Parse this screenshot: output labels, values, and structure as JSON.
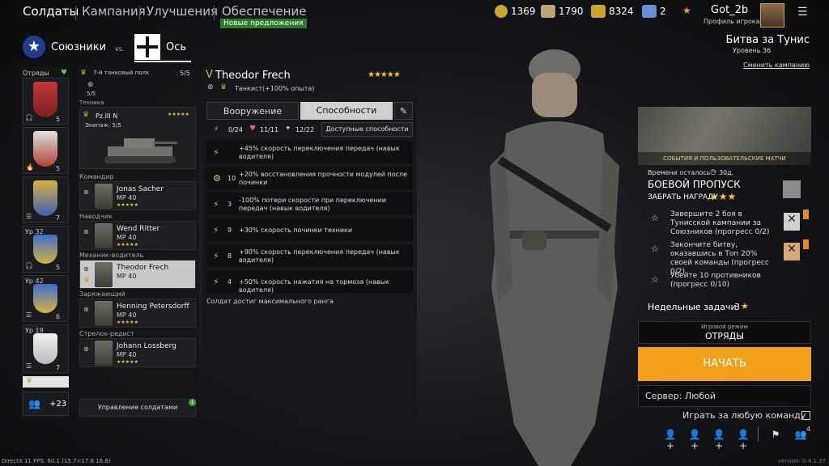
{
  "nav": {
    "tabs": [
      "Солдаты",
      "Кампания",
      "Улучшения",
      "Обеспечение"
    ],
    "new_offers": "Новые предложения"
  },
  "currency": [
    {
      "name": "gold",
      "value": "1369",
      "color": "#c9a534"
    },
    {
      "name": "silver-cards",
      "value": "1790",
      "color": "#b9a57a"
    },
    {
      "name": "gold-cards",
      "value": "8324",
      "color": "#c9a534"
    },
    {
      "name": "blue-cards",
      "value": "2",
      "color": "#6b8fd6"
    }
  ],
  "player": {
    "name": "Got_2b",
    "profile_label": "Профиль игрока"
  },
  "factions": {
    "allies": "Союзники",
    "vs": "vs.",
    "axis": "Ось"
  },
  "campaign": {
    "title": "Битва за Тунис",
    "level": "Уровень 36",
    "change": "Сменить кампанию"
  },
  "squads": {
    "header": "Отряды",
    "cards": [
      {
        "count": "5"
      },
      {
        "count": "5"
      },
      {
        "count": "7"
      },
      {
        "level": "Ур 32",
        "count": "5"
      },
      {
        "level": "Ур 42",
        "count": "6"
      },
      {
        "level": "Ур 19",
        "count": "7"
      }
    ],
    "extra": "+23"
  },
  "squad_detail": {
    "name": "7-й танковый полк",
    "capacity": "5/5",
    "sub_capacity": "5/5",
    "vehicle_label": "Техника",
    "vehicle_name": "Pz.III N",
    "crew": "Экипаж: 5/5",
    "manage": "Управление солдатами",
    "manage_badge": "1",
    "soldiers": [
      {
        "role": "Командир",
        "name": "Jonas Sacher",
        "weapon": "MP 40"
      },
      {
        "role": "Наводчик",
        "name": "Wend Ritter",
        "weapon": "MP 40"
      },
      {
        "role": "Механик-водитель",
        "name": "Theodor Frech",
        "weapon": "MP 40"
      },
      {
        "role": "Заряжающий",
        "name": "Henning Petersdorff",
        "weapon": "MP 40"
      },
      {
        "role": "Стрелок-радист",
        "name": "Johann Lossberg",
        "weapon": "MP 40"
      }
    ]
  },
  "soldier": {
    "rank": "V",
    "name": "Theodor Frech",
    "stars": "★★★★★",
    "class": "Танкист",
    "bonus": "(+100% опыта)",
    "tab_weapons": "Вооружение",
    "tab_abilities": "Способности",
    "stats": [
      {
        "value": "0/24",
        "color": "#7fd67f"
      },
      {
        "value": "11/11",
        "color": "#e06a6a"
      },
      {
        "value": "12/22",
        "color": "#e9d27a"
      }
    ],
    "available": "Доступные способности",
    "skills": [
      {
        "num": "",
        "text": "+45% скорость переключения передач (навык водителя)"
      },
      {
        "num": "10",
        "text": "+20% восстановления прочности модулей после починки"
      },
      {
        "num": "3",
        "text": "-100% потери скорости при переключении передач (навык водителя)"
      },
      {
        "num": "9",
        "text": "+30% скорость починки техники"
      },
      {
        "num": "8",
        "text": "+90% скорость переключения передач (навык водителя)"
      },
      {
        "num": "4",
        "text": "+50% скорость нажатия на тормоза (навык водителя)"
      }
    ],
    "max_rank": "Солдат достиг максимального ранга"
  },
  "battlepass": {
    "banner": "СОБЫТИЯ И ПОЛЬЗОВАТЕЛЬСКИЕ МАТЧИ",
    "time_label": "Времени осталось",
    "time_value": "30д.",
    "title": "БОЕВОЙ ПРОПУСК",
    "claim": "ЗАБРАТЬ НАГРАДУ",
    "missions": [
      "Завершите 2 боя в Тунисской кампании за Союзников (прогресс 0/2)",
      "Закончите битву, оказавшись в Топ 20% своей команды (прогресс 0/2)",
      "Убейте 10 противников (прогресс 0/10)"
    ],
    "weekly_label": "Недельные задачи",
    "weekly_count": "3"
  },
  "mode": {
    "label": "Игровой режим",
    "value": "ОТРЯДЫ"
  },
  "start_label": "НАЧАТЬ",
  "server": "Сервер: Любой",
  "any_team": "Играть за любую команду",
  "friends_count": "4",
  "footer": {
    "fps": "DirectX 11 FPS: 60.1 (15.7<17.6 16.6)",
    "version": "version: 0.4.1.37"
  }
}
